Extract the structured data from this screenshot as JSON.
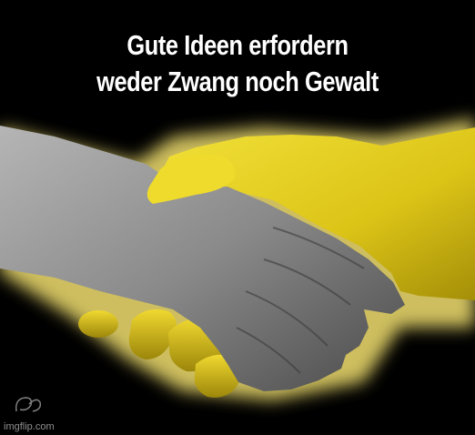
{
  "caption": {
    "line1": "Gute Ideen erfordern",
    "line2": "weder Zwang noch Gewalt"
  },
  "watermark": "imgflip.com",
  "colors": {
    "background": "#000000",
    "yellow_hand": "#e8d21a",
    "grey_hand": "#8a8a8a",
    "glow": "#f2e070",
    "caption_text": "#ffffff"
  }
}
